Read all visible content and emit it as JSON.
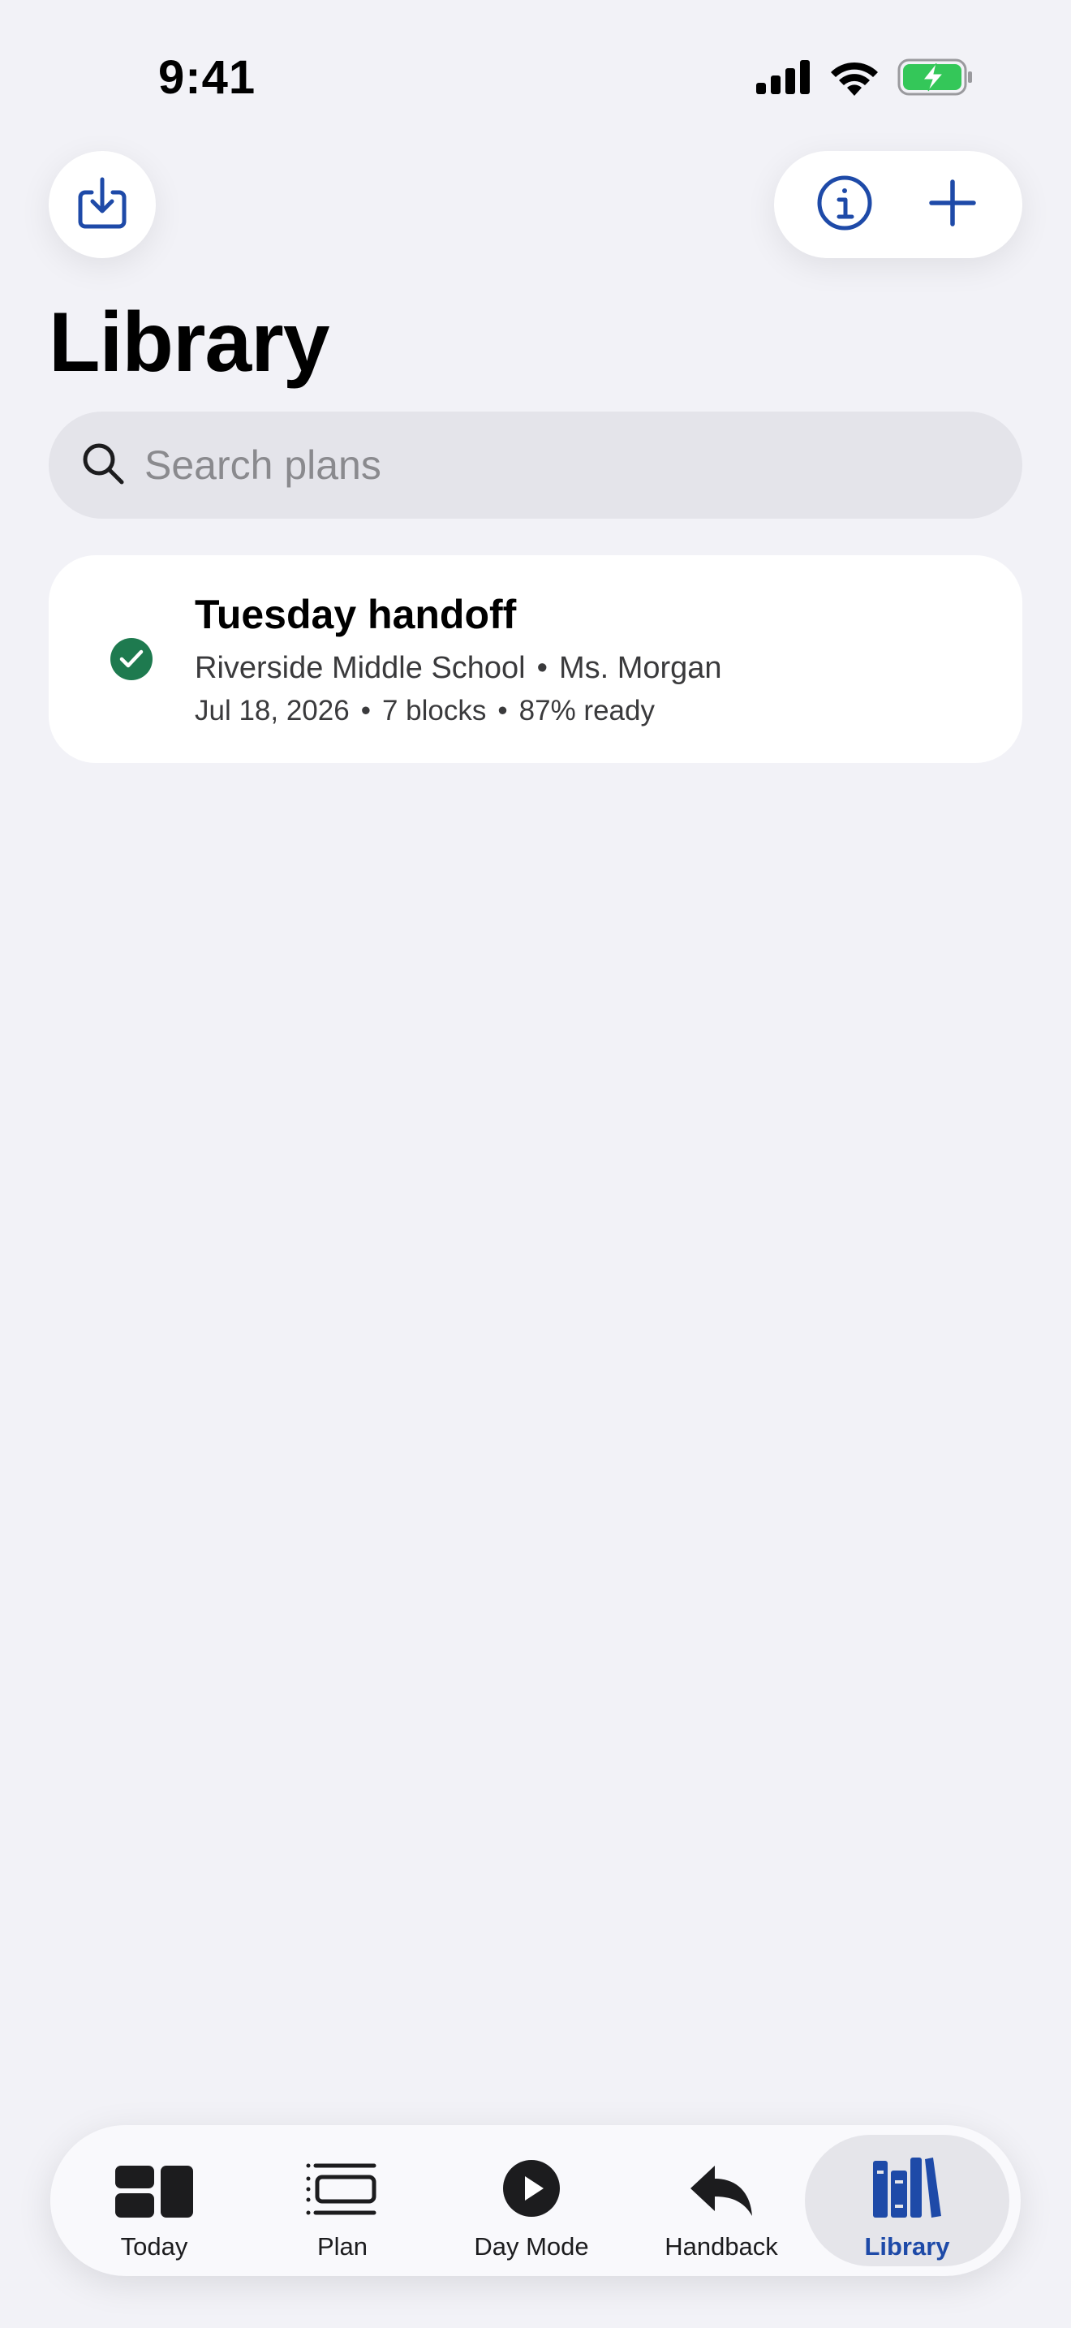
{
  "status_bar": {
    "time": "9:41"
  },
  "toolbar": {
    "import_icon": "tray-arrow-down-icon",
    "info_icon": "info-circle-icon",
    "add_icon": "plus-icon"
  },
  "page": {
    "title": "Library"
  },
  "search": {
    "placeholder": "Search plans"
  },
  "plans": [
    {
      "title": "Tuesday handoff",
      "school": "Riverside Middle School",
      "teacher": "Ms. Morgan",
      "date": "Jul 18, 2026",
      "blocks": "7 blocks",
      "ready": "87% ready",
      "status_icon": "checkmark-circle-icon"
    }
  ],
  "tabs": [
    {
      "label": "Today",
      "icon": "dashboard-icon"
    },
    {
      "label": "Plan",
      "icon": "list-rows-icon"
    },
    {
      "label": "Day Mode",
      "icon": "play-circle-icon"
    },
    {
      "label": "Handback",
      "icon": "reply-arrow-icon"
    },
    {
      "label": "Library",
      "icon": "books-icon",
      "active": true
    }
  ],
  "colors": {
    "accent": "#1e4aa8",
    "success": "#1e7a4f",
    "background": "#f2f2f7"
  }
}
